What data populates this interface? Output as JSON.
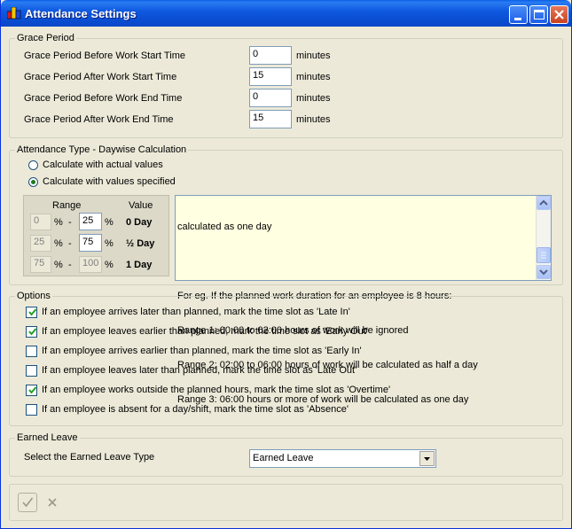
{
  "window": {
    "title": "Attendance Settings"
  },
  "grace": {
    "legend": "Grace Period",
    "unit": "minutes",
    "rows": [
      {
        "label": "Grace Period Before Work Start Time",
        "value": "0"
      },
      {
        "label": "Grace Period After Work Start Time",
        "value": "15"
      },
      {
        "label": "Grace Period Before Work End Time",
        "value": "0"
      },
      {
        "label": "Grace Period After Work End Time",
        "value": "15"
      }
    ]
  },
  "attendance": {
    "legend": "Attendance Type - Daywise Calculation",
    "radio_actual": "Calculate with actual values",
    "radio_specified": "Calculate with values specified",
    "selected": "specified",
    "range_header": "Range",
    "value_header": "Value",
    "pct": "%",
    "dash": "-",
    "ranges": [
      {
        "from": "0",
        "to": "25",
        "value": "0 Day"
      },
      {
        "from": "25",
        "to": "75",
        "value": "½ Day"
      },
      {
        "from": "75",
        "to": "100",
        "value": "1 Day"
      }
    ],
    "info_lines": [
      "calculated as one day",
      "",
      "For eg. If the planned work duration for an employee is 8 hours:",
      "Range 1: 00:00 to 02:00 hours of work will be ignored",
      "Range 2: 02:00 to 06:00 hours of work will be calculated as half a day",
      "Range 3: 06:00 hours or more of work will be calculated as one day"
    ]
  },
  "options": {
    "legend": "Options",
    "items": [
      {
        "label": "If an employee arrives later than planned, mark the time slot as 'Late In'",
        "checked": true
      },
      {
        "label": "If an employee leaves earlier than planned, mark the time slot as 'Early Out'",
        "checked": true
      },
      {
        "label": "If an employee arrives earlier than planned, mark the time slot as 'Early In'",
        "checked": false
      },
      {
        "label": "If an employee leaves later than planned, mark the time slot as 'Late Out'",
        "checked": false
      },
      {
        "label": "If an employee works outside the planned hours, mark the time slot as 'Overtime'",
        "checked": true
      },
      {
        "label": "If an employee is absent for a day/shift, mark the time slot as 'Absence'",
        "checked": false
      }
    ]
  },
  "earned": {
    "legend": "Earned Leave",
    "label": "Select the Earned Leave Type",
    "value": "Earned Leave"
  },
  "colors": {
    "title_bar": "#0a4fd4",
    "window_bg": "#ece9d8",
    "info_bg": "#ffffe1",
    "check_green": "#21a121"
  }
}
